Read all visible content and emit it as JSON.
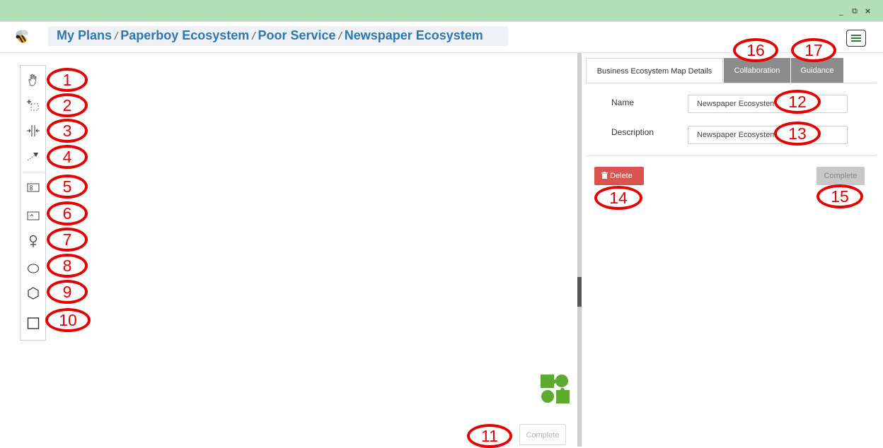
{
  "window_controls": {
    "minimize": "_",
    "restore": "⧉",
    "close": "×"
  },
  "breadcrumb": {
    "items": [
      "My Plans",
      "Paperboy Ecosystem",
      "Poor Service",
      "Newspaper Ecosystem"
    ],
    "separator": "/"
  },
  "toolbox": {
    "tools": [
      "hand-pan-tool",
      "select-tool",
      "spacing-tool",
      "connect-tool",
      "swimlane-tool",
      "group-tool",
      "actor-tool",
      "ellipse-tool",
      "hexagon-tool",
      "rectangle-tool"
    ]
  },
  "callouts": [
    "1",
    "2",
    "3",
    "4",
    "5",
    "6",
    "7",
    "8",
    "9",
    "10",
    "11",
    "12",
    "13",
    "14",
    "15",
    "16",
    "17"
  ],
  "canvas": {
    "complete_label": "Complete"
  },
  "tabs": [
    {
      "label": "Business Ecosystem Map Details",
      "active": true
    },
    {
      "label": "Collaboration",
      "active": false
    },
    {
      "label": "Guidance",
      "active": false
    }
  ],
  "form": {
    "name_label": "Name",
    "name_value": "Newspaper Ecosystem",
    "description_label": "Description",
    "description_value": "Newspaper Ecosystem"
  },
  "actions": {
    "delete_label": "Delete",
    "complete_label": "Complete"
  },
  "colors": {
    "titlebar": "#b2dfb5",
    "link": "#2f76b6",
    "callout": "#e60000",
    "delete": "#d9534f",
    "puzzle": "#5dab2e"
  }
}
